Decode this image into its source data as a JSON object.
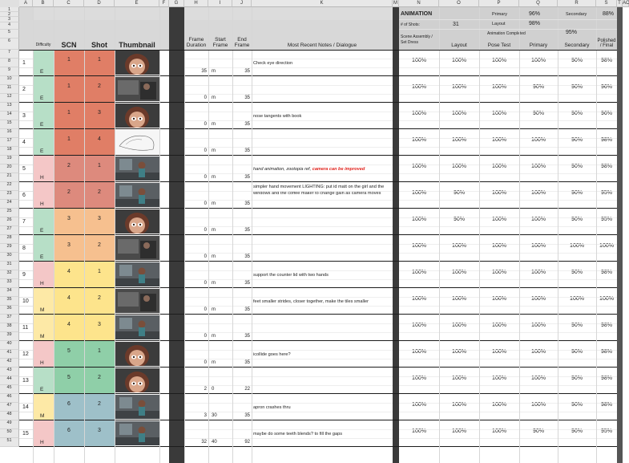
{
  "column_letters": [
    "A",
    "B",
    "C",
    "D",
    "E",
    "F",
    "G",
    "H",
    "I",
    "J",
    "K",
    "M",
    "N",
    "O",
    "P",
    "Q",
    "R",
    "S",
    "T",
    "AC"
  ],
  "headers": {
    "difficulty": "Difficulty",
    "scn": "SCN",
    "shot": "Shot",
    "thumbnail": "Thumbnail",
    "frame_duration": "Frame Duration",
    "start_frame": "Start Frame",
    "end_frame": "End Frame",
    "notes": "Most Recent Notes / Dialogue"
  },
  "summary": {
    "animation_label": "ANIMATION",
    "shots_label": "# of Shots:",
    "shots_value": "31",
    "primary_label": "Primary",
    "primary_value": "96%",
    "secondary_label": "Secondary",
    "secondary_value": "88%",
    "layout_label": "Layout",
    "layout_value": "98%",
    "anim_completed_label": "Animation Completed",
    "anim_completed_value": "95%",
    "scene_assembly_label": "Scene Assembly / Set Dress",
    "col_layout": "Layout",
    "col_pose": "Pose Test",
    "col_primary": "Primary",
    "col_secondary": "Secondary",
    "col_polished": "Polished / Final"
  },
  "colors": {
    "diff_E": "#b7dfc7",
    "diff_H": "#f4c7c7",
    "diff_M": "#fde9a6",
    "scn1": "#e07e66",
    "scn2": "#dd8a7d",
    "scn3": "#f6c08f",
    "scn4": "#fde48c",
    "scn5": "#8fcfa8",
    "scn6": "#9ec0c9"
  },
  "rows": [
    {
      "num": "1",
      "diff": "E",
      "scn": "1",
      "shot": "1",
      "dur": "35",
      "start": "m",
      "end": "35",
      "note": "Check eye direction",
      "pct": [
        "100%",
        "100%",
        "100%",
        "100%",
        "90%",
        "98%"
      ]
    },
    {
      "num": "2",
      "diff": "E",
      "scn": "1",
      "shot": "2",
      "dur": "0",
      "start": "m",
      "end": "35",
      "note": "",
      "pct": [
        "100%",
        "100%",
        "100%",
        "90%",
        "90%",
        "96%"
      ]
    },
    {
      "num": "3",
      "diff": "E",
      "scn": "1",
      "shot": "3",
      "dur": "0",
      "start": "m",
      "end": "35",
      "note": "nose tangents with book",
      "pct": [
        "100%",
        "100%",
        "100%",
        "90%",
        "90%",
        "96%"
      ]
    },
    {
      "num": "4",
      "diff": "E",
      "scn": "1",
      "shot": "4",
      "dur": "0",
      "start": "m",
      "end": "35",
      "note": "",
      "pct": [
        "100%",
        "100%",
        "100%",
        "100%",
        "90%",
        "98%"
      ]
    },
    {
      "num": "5",
      "diff": "H",
      "scn": "2",
      "shot": "1",
      "dur": "0",
      "start": "m",
      "end": "35",
      "note": "hand animation, zootopia ref, ",
      "note_red": "camera can be improved",
      "pct": [
        "100%",
        "100%",
        "100%",
        "100%",
        "90%",
        "98%"
      ]
    },
    {
      "num": "6",
      "diff": "H",
      "scn": "2",
      "shot": "2",
      "dur": "0",
      "start": "m",
      "end": "35",
      "note": "simpler hand movement LIGHTING: put id matt on the girl and the windows and the coffee maker to change gain as camera moves",
      "pct": [
        "100%",
        "90%",
        "100%",
        "100%",
        "90%",
        "95%"
      ]
    },
    {
      "num": "7",
      "diff": "E",
      "scn": "3",
      "shot": "3",
      "dur": "0",
      "start": "m",
      "end": "35",
      "note": "",
      "pct": [
        "100%",
        "90%",
        "100%",
        "100%",
        "90%",
        "95%"
      ]
    },
    {
      "num": "8",
      "diff": "E",
      "scn": "3",
      "shot": "2",
      "dur": "0",
      "start": "m",
      "end": "35",
      "note": "",
      "pct": [
        "100%",
        "100%",
        "100%",
        "100%",
        "100%",
        "100%"
      ]
    },
    {
      "num": "9",
      "diff": "H",
      "scn": "4",
      "shot": "1",
      "dur": "0",
      "start": "m",
      "end": "35",
      "note": "support the counter lid with two hands",
      "pct": [
        "100%",
        "100%",
        "100%",
        "100%",
        "90%",
        "98%"
      ]
    },
    {
      "num": "10",
      "diff": "M",
      "scn": "4",
      "shot": "2",
      "dur": "0",
      "start": "m",
      "end": "35",
      "note": "feet smaller strides, closer together, make the tiles smaller",
      "pct": [
        "100%",
        "100%",
        "100%",
        "100%",
        "100%",
        "100%"
      ]
    },
    {
      "num": "11",
      "diff": "M",
      "scn": "4",
      "shot": "3",
      "dur": "0",
      "start": "m",
      "end": "35",
      "note": "",
      "pct": [
        "100%",
        "100%",
        "100%",
        "100%",
        "90%",
        "98%"
      ]
    },
    {
      "num": "12",
      "diff": "H",
      "scn": "5",
      "shot": "1",
      "dur": "0",
      "start": "m",
      "end": "35",
      "note": "icollide goes here?",
      "pct": [
        "100%",
        "100%",
        "100%",
        "100%",
        "90%",
        "98%"
      ]
    },
    {
      "num": "13",
      "diff": "E",
      "scn": "5",
      "shot": "2",
      "dur": "2",
      "start": "0",
      "end": "22",
      "note": "",
      "pct": [
        "100%",
        "100%",
        "100%",
        "100%",
        "90%",
        "98%"
      ]
    },
    {
      "num": "14",
      "diff": "M",
      "scn": "6",
      "shot": "2",
      "dur": "3",
      "start": "30",
      "end": "35",
      "note": "apron crashes thru",
      "pct": [
        "100%",
        "100%",
        "100%",
        "100%",
        "90%",
        "98%"
      ]
    },
    {
      "num": "15",
      "diff": "H",
      "scn": "6",
      "shot": "3",
      "dur": "32",
      "start": "40",
      "end": "92",
      "note": "maybe do some teeth blends? to fill the gaps",
      "pct": [
        "100%",
        "100%",
        "100%",
        "90%",
        "90%",
        "95%"
      ]
    }
  ]
}
